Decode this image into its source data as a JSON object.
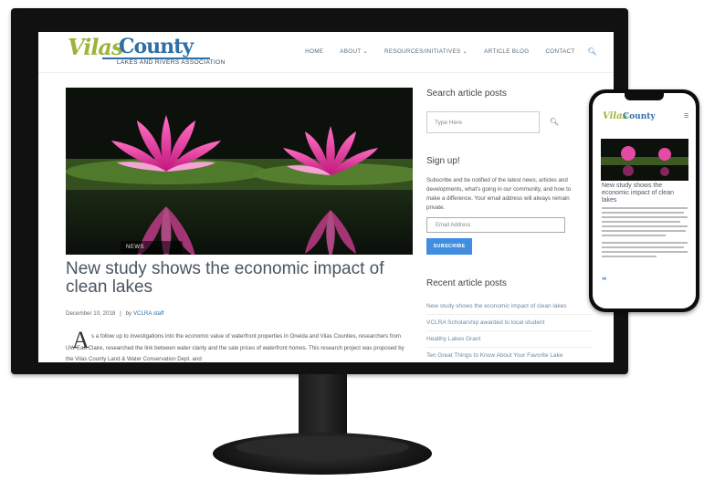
{
  "site": {
    "logo_main_1": "Vilas",
    "logo_main_2": "County",
    "logo_sub": "LAKES AND RIVERS ASSOCIATION"
  },
  "nav": {
    "items": [
      {
        "label": "HOME"
      },
      {
        "label": "ABOUT ⌄"
      },
      {
        "label": "RESOURCES/INITIATIVES ⌄"
      },
      {
        "label": "ARTICLE BLOG"
      },
      {
        "label": "CONTACT"
      }
    ],
    "search_icon": "search-icon"
  },
  "article": {
    "tag": "NEWS",
    "title": "New study shows the economic impact of clean lakes",
    "date": "December 10, 2018",
    "by": "by",
    "author": "VCLRA staff",
    "dropcap": "A",
    "body": "s a follow up to investigations into the economic value of waterfront properties in Oneida and Vilas Counties, researchers from UW-Eau Claire, researched the link between water clarity and the sale prices of waterfront homes. This research project was proposed by the Vilas County Land & Water Conservation Dept. and"
  },
  "sidebar": {
    "search_heading": "Search article posts",
    "search_placeholder": "Type Here",
    "signup_heading": "Sign up!",
    "signup_text": "Subscribe and be notified of the latest news, articles and developments, what's going in our community, and how to make a difference. Your email address will always remain private.",
    "email_placeholder": "Email Address",
    "subscribe_label": "SUBSCRIBE",
    "recent_heading": "Recent article posts",
    "recent": [
      "New study shows the economic impact of clean lakes",
      "VCLRA Scholarship awarded to local student",
      "Healthy Lakes Grant",
      "Ten Great Things to Know About Your Favorite Lake"
    ]
  },
  "phone": {
    "logo_1": "Vilas",
    "logo_2": "County",
    "title": "New study shows the economic impact of clean lakes"
  },
  "colors": {
    "accent_blue": "#2f6fa7",
    "logo_green": "#9bb63a",
    "button_blue": "#3f8ee0"
  }
}
